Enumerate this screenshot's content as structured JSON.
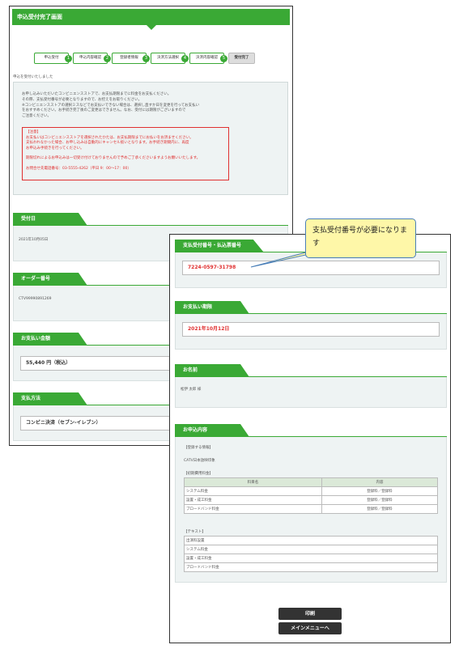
{
  "back": {
    "title": "申込受付完了画面",
    "steps": [
      {
        "label": "申込受付",
        "num": "1"
      },
      {
        "label": "申込内容確認",
        "num": "2"
      },
      {
        "label": "登録者情報",
        "num": "3"
      },
      {
        "label": "決済方法選択",
        "num": "4"
      },
      {
        "label": "決済内容確認",
        "num": "5"
      },
      {
        "label": "受付完了",
        "num": ""
      }
    ],
    "received_note": "申込を受付いたしました",
    "notice_lines": [
      "お申し込みいただいたコンビニエンスストアで、お支払期限までに料金をお支払ください。",
      "その際、支払受付番号が必要となりますので、お控えをお取りください。",
      "※コンビニエンスストアの選択ミスなどでお支払いできない場合は、選択し直すか日を変更を行ってお支払い",
      "をおすすめください。お手続き完了後のご変更はできません。なお、受付には期限がございますので",
      "ご注意ください。"
    ],
    "warning_lines": [
      "【注意】",
      "お支払いはコンビニエンスストアを選択されたかたは、お支払期限までにお払いをお済ませください。",
      "支払われなかった場合、お申し込みは自動的にキャンセル扱いとなります。お手続き期間内に、再度",
      "お申込み手続きを行ってください。",
      "",
      "期限切れによるお申込みは一切受け付けておりませんので予めご了承くださいますようお願いいたします。",
      "",
      "お問合せ先電話番号：03-5555-4262（平日 9：00〜17：00）"
    ],
    "sections": [
      {
        "title": "受付日",
        "value": "2021年10月05日"
      },
      {
        "title": "オーダー番号",
        "value": "CTV99990891269"
      },
      {
        "title": "お支払い金額",
        "value": "55,440 円（税込）"
      },
      {
        "title": "支払方法",
        "value": "コンビニ決済（セブン-イレブン）"
      }
    ]
  },
  "front": {
    "sections": [
      {
        "title": "支払受付番号・払込票番号",
        "value": "7224-0597-31798"
      },
      {
        "title": "お支払い期限",
        "value": "2021年10月12日"
      },
      {
        "title": "お名前",
        "value": "松伊 太郎 様"
      },
      {
        "title": "お申込内容",
        "value": ""
      }
    ],
    "contract": {
      "heading": "【登録する情報】",
      "service": "CATV日本放映印象",
      "fees_heading": "【初期費用料金】",
      "table_headers": [
        "料目名",
        "内容"
      ],
      "table_rows": [
        [
          "システム料金",
          "登録料／登録料"
        ],
        [
          "設置・成工料金",
          "登録料／登録料"
        ],
        [
          "ブロードバンド料金",
          "登録料／登録料"
        ]
      ],
      "text_heading": "【テキスト】",
      "text_rows": [
        "出演料設置",
        "システム料金",
        "設置・成工料金",
        "ブロードバンド料金"
      ]
    },
    "buttons": {
      "print": "印刷",
      "main_menu": "メインメニューへ"
    }
  },
  "callout": {
    "text": "支払受付番号が必要になります"
  },
  "colors": {
    "accent": "#3aa935",
    "warning": "#e03030",
    "balloon": "#fef7a8"
  }
}
